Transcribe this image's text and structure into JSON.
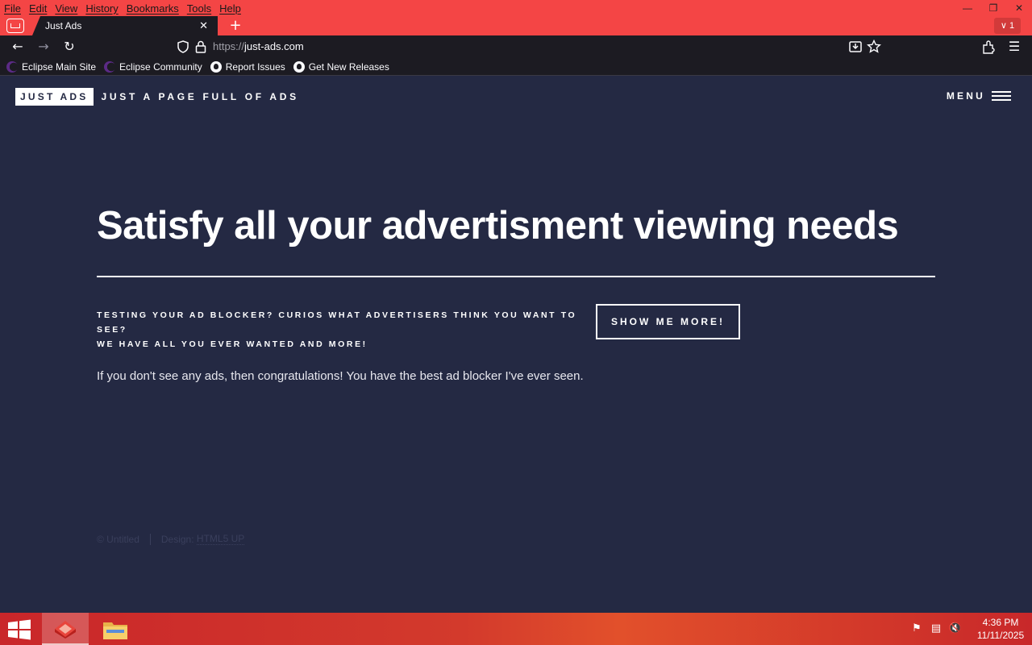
{
  "browser": {
    "menu": [
      "File",
      "Edit",
      "View",
      "History",
      "Bookmarks",
      "Tools",
      "Help"
    ],
    "tab_title": "Just Ads",
    "tab_count": "1",
    "url_prefix": "https://",
    "url_host": "just-ads.com",
    "bookmarks": [
      "Eclipse Main Site",
      "Eclipse Community",
      "Report Issues",
      "Get New Releases"
    ],
    "theme_color": "#f44545"
  },
  "site": {
    "logo": "JUST ADS",
    "tagline": "JUST A PAGE FULL OF ADS",
    "menu_label": "MENU",
    "hero_title": "Satisfy all your advertisment viewing needs",
    "hero_sub_line1": "TESTING YOUR AD BLOCKER? CURIOS WHAT ADVERTISERS THINK YOU WANT TO SEE?",
    "hero_sub_line2": "WE HAVE ALL YOU EVER WANTED AND MORE!",
    "cta_label": "SHOW ME MORE!",
    "note": "If you don't see any ads, then congratulations! You have the best ad blocker I've ever seen.",
    "footer_copyright": "© Untitled",
    "footer_design_label": "Design:",
    "footer_design_link": "HTML5 UP",
    "background_color": "#242943"
  },
  "taskbar": {
    "time": "4:36 PM",
    "date": "11/11/2025"
  }
}
